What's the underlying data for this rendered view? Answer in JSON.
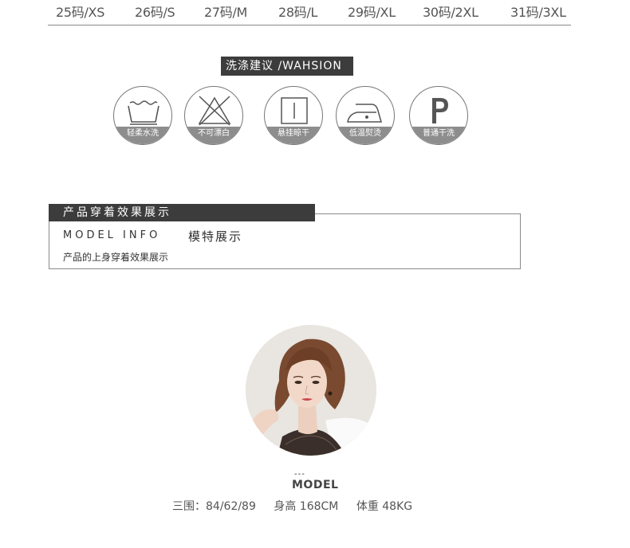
{
  "sizes": [
    "25码/XS",
    "26码/S",
    "27码/M",
    "28码/L",
    "29码/XL",
    "30码/2XL",
    "31码/3XL"
  ],
  "wash": {
    "title": "洗涤建议 /WAHSION",
    "icons": [
      {
        "label": "轻柔水洗",
        "icon": "gentle-wash-icon"
      },
      {
        "label": "不可漂白",
        "icon": "no-bleach-icon"
      },
      {
        "label": "悬挂晾干",
        "icon": "hang-dry-icon"
      },
      {
        "label": "低温熨烫",
        "icon": "low-iron-icon"
      },
      {
        "label": "普通干洗",
        "icon": "dry-clean-icon"
      }
    ]
  },
  "show": {
    "title": "产品穿着效果展示",
    "info_en": "MODEL INFO",
    "info_cn": "模特展示",
    "subtitle": "产品的上身穿着效果展示"
  },
  "model": {
    "dash": "---",
    "label": "MODEL",
    "measurements": "三围：84/62/89",
    "height": "身高 168CM",
    "weight": "体重 48KG"
  },
  "colors": {
    "heading_bg": "#3c3c3c",
    "icon_label_bg": "#8d8d8d",
    "border": "#8a8a8a"
  }
}
